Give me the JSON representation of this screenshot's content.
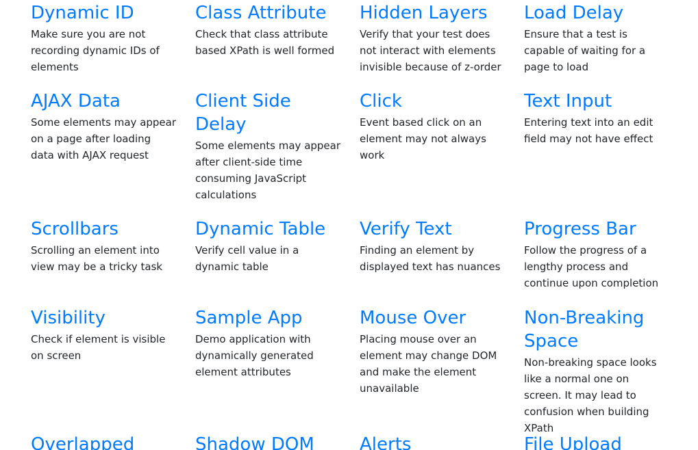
{
  "cards": [
    {
      "title": "Dynamic ID",
      "desc": "Make sure you are not recording dynamic IDs of elements"
    },
    {
      "title": "Class Attribute",
      "desc": "Check that class attribute based XPath is well formed"
    },
    {
      "title": "Hidden Layers",
      "desc": "Verify that your test does not interact with elements invisible because of z-order"
    },
    {
      "title": "Load Delay",
      "desc": "Ensure that a test is capable of waiting for a page to load"
    },
    {
      "title": "AJAX Data",
      "desc": "Some elements may appear on a page after loading data with AJAX request"
    },
    {
      "title": "Client Side Delay",
      "desc": "Some elements may appear after client-side time consuming JavaScript calculations"
    },
    {
      "title": "Click",
      "desc": "Event based click on an element may not always work"
    },
    {
      "title": "Text Input",
      "desc": "Entering text into an edit field may not have effect"
    },
    {
      "title": "Scrollbars",
      "desc": "Scrolling an element into view may be a tricky task"
    },
    {
      "title": "Dynamic Table",
      "desc": "Verify cell value in a dynamic table"
    },
    {
      "title": "Verify Text",
      "desc": "Finding an element by displayed text has nuances"
    },
    {
      "title": "Progress Bar",
      "desc": "Follow the progress of a lengthy process and continue upon completion"
    },
    {
      "title": "Visibility",
      "desc": "Check if element is visible on screen"
    },
    {
      "title": "Sample App",
      "desc": "Demo application with dynamically generated element attributes"
    },
    {
      "title": "Mouse Over",
      "desc": "Placing mouse over an element may change DOM and make the element unavailable"
    },
    {
      "title": "Non-Breaking Space",
      "desc": "Non-breaking space looks like a normal one on screen. It may lead to confusion when building XPath"
    },
    {
      "title": "Overlapped"
    },
    {
      "title": "Shadow DOM"
    },
    {
      "title": "Alerts"
    },
    {
      "title": "File Upload"
    }
  ],
  "colors": {
    "link": "#007bff",
    "text": "#212529",
    "background": "#ffffff"
  }
}
